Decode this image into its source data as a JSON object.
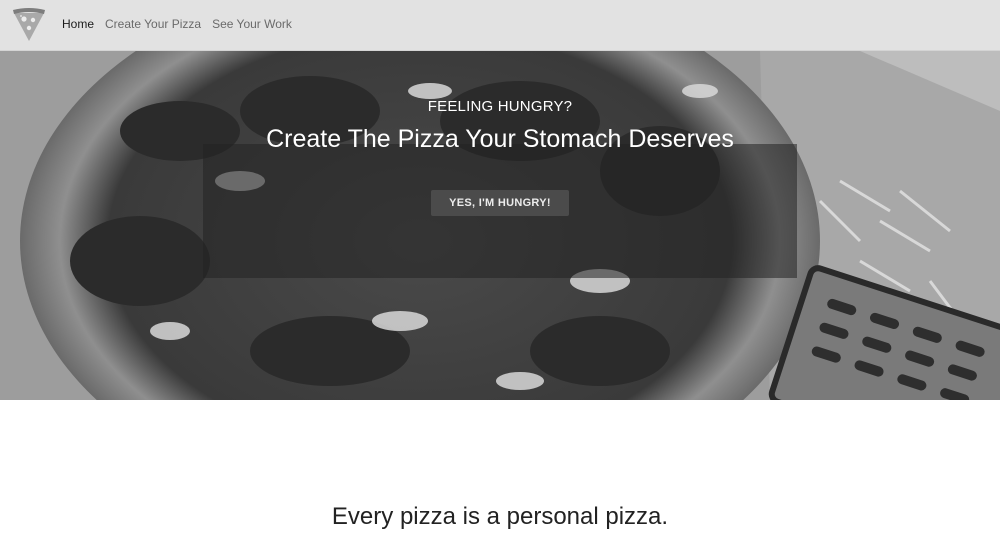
{
  "nav": {
    "logo_icon": "pizza-slice-icon",
    "items": [
      {
        "label": "Home",
        "active": true
      },
      {
        "label": "Create Your Pizza",
        "active": false
      },
      {
        "label": "See Your Work",
        "active": false
      }
    ]
  },
  "hero": {
    "background": "pizza-photo-grayscale",
    "eyebrow": "FEELING HUNGRY?",
    "title": "Create The Pizza Your Stomach Deserves",
    "cta_label": "YES, I'M HUNGRY!"
  },
  "section": {
    "heading": "Every pizza is a personal pizza."
  },
  "colors": {
    "navbar_bg": "#e2e2e2",
    "button_bg": "#4b4b4b",
    "overlay": "#232323"
  }
}
